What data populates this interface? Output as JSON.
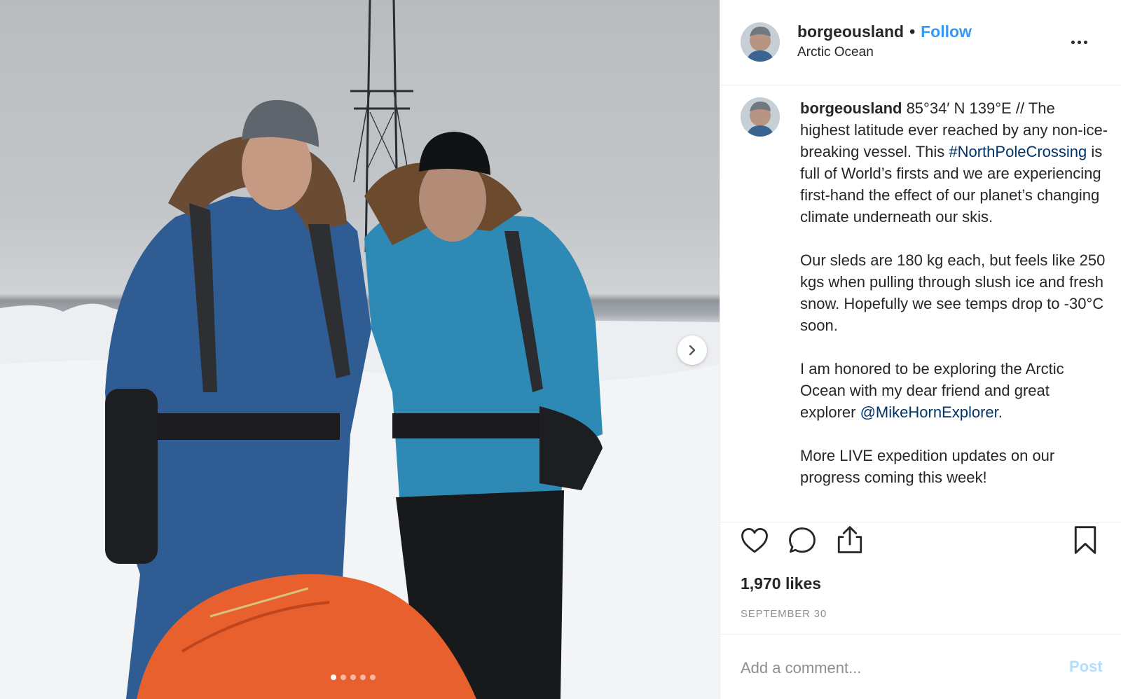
{
  "post": {
    "username": "borgeousland",
    "follow_label": "Follow",
    "separator": "•",
    "location": "Arctic Ocean"
  },
  "caption": {
    "username": "borgeousland",
    "para1_a": " 85°34′ N 139°E // The highest latitude ever reached by any non-ice-breaking vessel. This ",
    "hashtag": "#NorthPoleCrossing",
    "para1_b": " is full of World’s firsts and we are experiencing first-hand the effect of our planet’s changing climate underneath our skis.",
    "para2": "Our sleds are 180 kg each, but feels like 250 kgs when pulling through slush ice and fresh snow. Hopefully we see temps drop to -30°C soon.",
    "para3_a": "I am honored to be exploring the Arctic Ocean with my dear friend and great explorer ",
    "mention": "@MikeHornExplorer",
    "para3_b": ".",
    "para4": "More LIVE expedition updates on our progress coming this week!"
  },
  "stats": {
    "likes": "1,970 likes",
    "date": "SEPTEMBER 30"
  },
  "comment": {
    "placeholder": "Add a comment...",
    "post_label": "Post"
  },
  "carousel": {
    "slide_count": 5,
    "active_index": 0
  },
  "colors": {
    "follow": "#3897f0",
    "link": "#003569",
    "post_disabled": "#b2dffc",
    "muted": "#8e8e8e"
  },
  "icons": [
    "next-arrow-icon",
    "more-options-icon",
    "heart-icon",
    "comment-icon",
    "share-icon",
    "bookmark-icon"
  ]
}
